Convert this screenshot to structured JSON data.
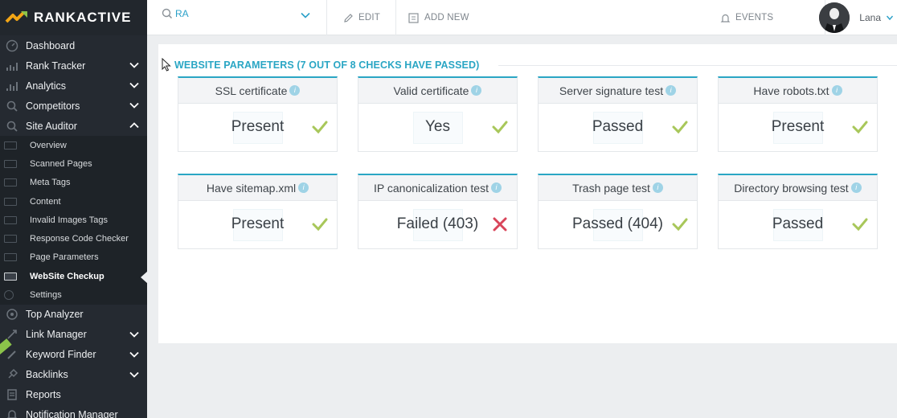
{
  "brand": {
    "name_part1": "RANK",
    "name_part2": "ACTIVE"
  },
  "sidebar": {
    "items": [
      {
        "label": "Dashboard",
        "icon": "dashboard-icon",
        "expandable": false
      },
      {
        "label": "Rank Tracker",
        "icon": "rank-tracker-icon",
        "expandable": true
      },
      {
        "label": "Analytics",
        "icon": "analytics-icon",
        "expandable": true
      },
      {
        "label": "Competitors",
        "icon": "competitors-icon",
        "expandable": true
      },
      {
        "label": "Site Auditor",
        "icon": "site-auditor-icon",
        "expandable": true,
        "expanded": true
      }
    ],
    "sub_items": [
      {
        "label": "Overview"
      },
      {
        "label": "Scanned Pages"
      },
      {
        "label": "Meta Tags"
      },
      {
        "label": "Content"
      },
      {
        "label": "Invalid Images Tags"
      },
      {
        "label": "Response Code Checker"
      },
      {
        "label": "Page Parameters"
      },
      {
        "label": "WebSite Checkup",
        "active": true
      },
      {
        "label": "Settings"
      }
    ],
    "items_after": [
      {
        "label": "Top Analyzer",
        "icon": "top-analyzer-icon",
        "expandable": false
      },
      {
        "label": "Link Manager",
        "icon": "link-manager-icon",
        "expandable": true
      },
      {
        "label": "Keyword Finder",
        "icon": "keyword-finder-icon",
        "expandable": true
      },
      {
        "label": "Backlinks",
        "icon": "backlinks-icon",
        "expandable": true
      },
      {
        "label": "Reports",
        "icon": "reports-icon",
        "expandable": false
      },
      {
        "label": "Notification Manager",
        "icon": "notification-icon",
        "expandable": false
      }
    ]
  },
  "topbar": {
    "project": "RA",
    "edit": "EDIT",
    "add_new": "ADD NEW",
    "events": "EVENTS",
    "user": "Lana"
  },
  "panel": {
    "title": "WEBSITE PARAMETERS (7 OUT OF 8 CHECKS HAVE PASSED)",
    "checks": [
      {
        "title": "SSL certificate",
        "value": "Present",
        "status": "pass"
      },
      {
        "title": "Valid certificate",
        "value": "Yes",
        "status": "pass"
      },
      {
        "title": "Server signature test",
        "value": "Passed",
        "status": "pass"
      },
      {
        "title": "Have robots.txt",
        "value": "Present",
        "status": "pass"
      },
      {
        "title": "Have sitemap.xml",
        "value": "Present",
        "status": "pass"
      },
      {
        "title": "IP canonicalization test",
        "value": "Failed (403)",
        "status": "fail"
      },
      {
        "title": "Trash page test",
        "value": "Passed (404)",
        "status": "pass"
      },
      {
        "title": "Directory browsing test",
        "value": "Passed",
        "status": "pass"
      }
    ]
  },
  "colors": {
    "accent": "#2aa6c4",
    "pass": "#a8c75a",
    "fail": "#d9455a",
    "sidebar": "#252a31"
  }
}
